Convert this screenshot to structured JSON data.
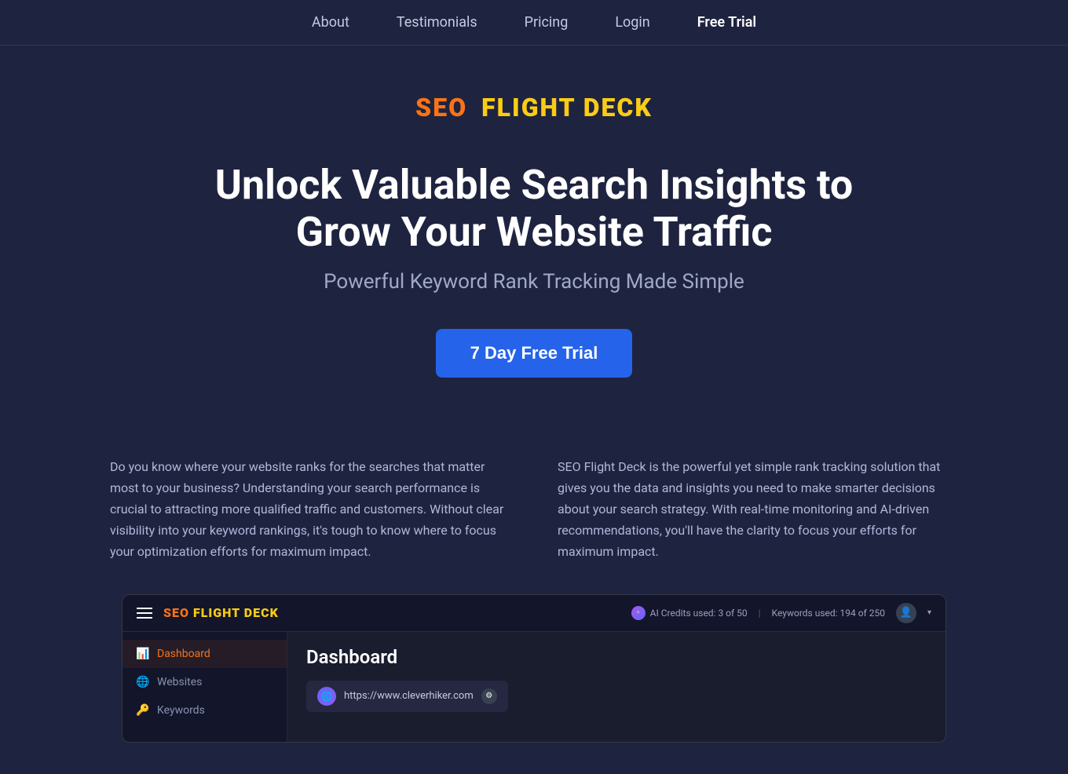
{
  "nav": {
    "items": [
      {
        "label": "About",
        "id": "about"
      },
      {
        "label": "Testimonials",
        "id": "testimonials"
      },
      {
        "label": "Pricing",
        "id": "pricing"
      },
      {
        "label": "Login",
        "id": "login"
      },
      {
        "label": "Free Trial",
        "id": "free-trial",
        "highlight": true
      }
    ]
  },
  "logo": {
    "seo": "SEO",
    "rest": "FLIGHT DECK"
  },
  "hero": {
    "headline": "Unlock Valuable Search Insights to Grow Your Website Traffic",
    "subheadline": "Powerful Keyword Rank Tracking Made Simple",
    "cta_label": "7 Day Free Trial"
  },
  "columns": {
    "left": "Do you know where your website ranks for the searches that matter most to your business? Understanding your search performance is crucial to attracting more qualified traffic and customers. Without clear visibility into your keyword rankings, it's tough to know where to focus your optimization efforts for maximum impact.",
    "right": "SEO Flight Deck is the powerful yet simple rank tracking solution that gives you the data and insights you need to make smarter decisions about your search strategy. With real-time monitoring and AI-driven recommendations, you'll have the clarity to focus your efforts for maximum impact."
  },
  "app_screenshot": {
    "topbar": {
      "logo_seo": "SEO",
      "logo_rest": "FLIGHT DECK",
      "ai_credits_label": "AI Credits used: 3 of 50",
      "keywords_used_label": "Keywords used: 194 of 250"
    },
    "sidebar": {
      "items": [
        {
          "label": "Dashboard",
          "icon": "📊",
          "active": true
        },
        {
          "label": "Websites",
          "icon": "🌐",
          "active": false
        },
        {
          "label": "Keywords",
          "icon": "🔑",
          "active": false
        }
      ]
    },
    "main": {
      "title": "Dashboard",
      "url": "https://www.cleverhiker.com"
    }
  }
}
